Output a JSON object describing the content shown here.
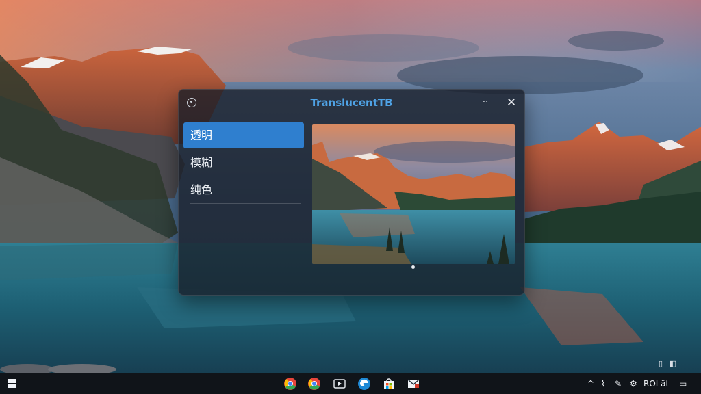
{
  "window": {
    "title": "TranslucentTB",
    "minimize_label": "··",
    "close_label": "✕"
  },
  "nav": {
    "items": [
      {
        "label": "透明",
        "selected": true
      },
      {
        "label": "模糊",
        "selected": false
      },
      {
        "label": "纯色",
        "selected": false
      }
    ]
  },
  "preview": {
    "page_count": 1,
    "current_page": 1
  },
  "taskbar": {
    "apps": [
      "chrome-icon",
      "chrome-icon",
      "media-icon",
      "edge-icon",
      "store-icon",
      "mail-icon"
    ],
    "tray": {
      "chevron": "^",
      "text": "ROI ät",
      "notification_icon": "notification-icon"
    }
  },
  "colors": {
    "accent": "#2f7fcf",
    "title": "#4fa3e6",
    "taskbar": "#101419"
  }
}
